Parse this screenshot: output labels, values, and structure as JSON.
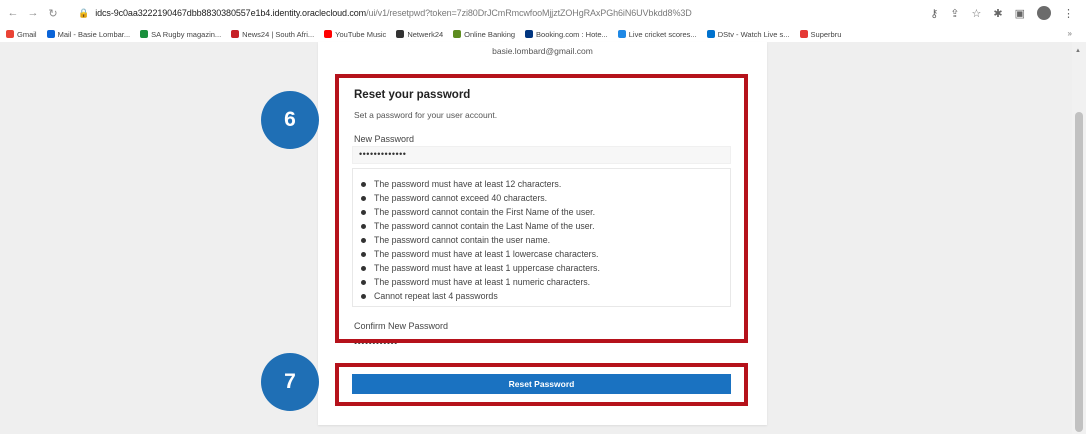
{
  "browser": {
    "url_host": "idcs-9c0aa3222190467dbb8830380557e1b4.identity.oraclecloud.com",
    "url_path": "/ui/v1/resetpwd?token=7zi80DrJCmRmcwfooMjjztZOHgRAxPGh6iN6UVbkdd8%3D",
    "bookmarks": [
      {
        "label": "Gmail",
        "color": "#ea4335"
      },
      {
        "label": "Mail - Basie Lombar...",
        "color": "#0a64d8"
      },
      {
        "label": "SA Rugby magazin...",
        "color": "#1a8f3c"
      },
      {
        "label": "News24 | South Afri...",
        "color": "#c62026"
      },
      {
        "label": "YouTube Music",
        "color": "#ff0000"
      },
      {
        "label": "Netwerk24",
        "color": "#333333"
      },
      {
        "label": "Online Banking",
        "color": "#5d8c1f"
      },
      {
        "label": "Booking.com : Hote...",
        "color": "#003580"
      },
      {
        "label": "Live cricket scores...",
        "color": "#1e88e5"
      },
      {
        "label": "DStv - Watch Live s...",
        "color": "#0072ce"
      },
      {
        "label": "Superbru",
        "color": "#e53935"
      }
    ],
    "more_label": "»"
  },
  "card": {
    "email": "basie.lombard@gmail.com",
    "title": "Reset your password",
    "subtitle": "Set a password for your user account.",
    "new_password_label": "New Password",
    "new_password_value": "•••••••••••••",
    "rules": [
      "The password must have at least 12 characters.",
      "The password cannot exceed 40 characters.",
      "The password cannot contain the First Name of the user.",
      "The password cannot contain the Last Name of the user.",
      "The password cannot contain the user name.",
      "The password must have at least 1 lowercase characters.",
      "The password must have at least 1 uppercase characters.",
      "The password must have at least 1 numeric characters.",
      "Cannot repeat last 4 passwords"
    ],
    "confirm_password_label": "Confirm New Password",
    "confirm_password_value": "••••••••••••",
    "reset_button": "Reset Password"
  },
  "annotations": {
    "step6": "6",
    "step7": "7",
    "highlight_color": "#b5121b",
    "badge_color": "#1f6fb5"
  }
}
